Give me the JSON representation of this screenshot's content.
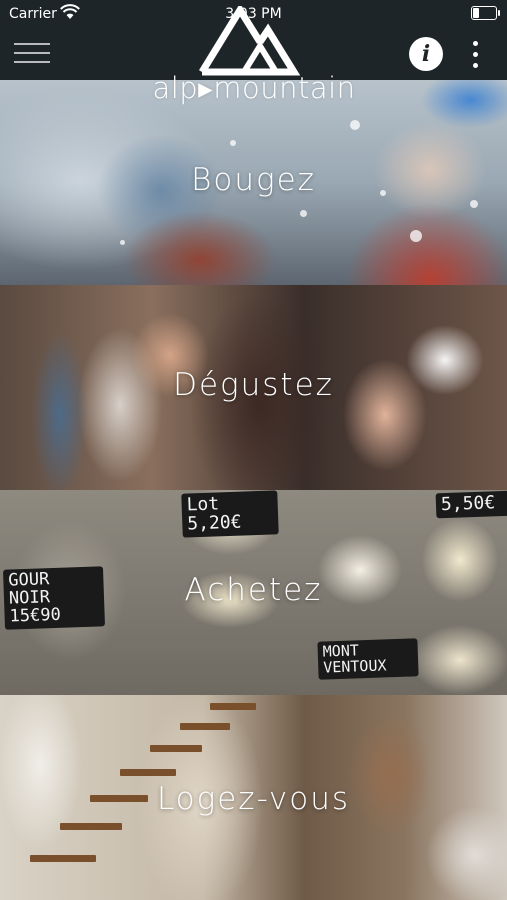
{
  "status_bar": {
    "carrier": "Carrier",
    "time": "3:03 PM",
    "wifi_icon": "wifi-icon",
    "battery_icon": "battery-icon"
  },
  "header": {
    "menu_icon": "hamburger-menu-icon",
    "logo_text": "alp▸mountain",
    "info_label": "i",
    "more_icon": "vertical-dots-icon"
  },
  "panels": [
    {
      "label": "Bougez"
    },
    {
      "label": "Dégustez"
    },
    {
      "label": "Achetez"
    },
    {
      "label": "Logez-vous"
    }
  ],
  "signs": {
    "sign1": "Lot 5,20€",
    "sign2": "5,50€",
    "sign3_line1": "GOUR",
    "sign3_line2": "NOIR",
    "sign3_line3": "15€90",
    "sign4_line1": "MONT",
    "sign4_line2": "VENTOUX"
  },
  "colors": {
    "header_bg": "#1e2529",
    "text": "#ffffff"
  }
}
